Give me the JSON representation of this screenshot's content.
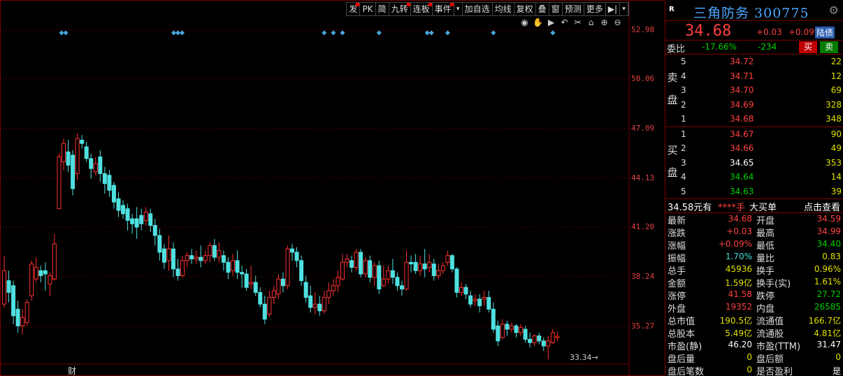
{
  "toolbar": [
    "发",
    "PK",
    "简",
    "九转",
    "连板",
    "事件",
    "▾",
    "加自选",
    "均线",
    "复权",
    "叠",
    "窗",
    "预测",
    "更多",
    "▶|",
    "▾"
  ],
  "toolbar_marked": [
    0,
    3,
    4,
    5
  ],
  "mini_tools": [
    "eye-icon",
    "hand-icon",
    "play-icon",
    "undo-icon",
    "scissors-icon",
    "lock-icon",
    "zoom-in-icon",
    "zoom-out-icon"
  ],
  "mini_glyphs": [
    "◉",
    "✋",
    "▶",
    "↶",
    "✂",
    "⌂",
    "⊕",
    "⊖"
  ],
  "price_axis": [
    "52.98",
    "50.06",
    "47.09",
    "44.13",
    "41.20",
    "38.24",
    "35.27"
  ],
  "bottom_tag": "财",
  "low_label": "33.34",
  "stock": {
    "r_badge": "R",
    "name": "三角防务 300775",
    "price": "34.68",
    "change": "+0.03",
    "change_pct": "+0.09%",
    "market": "陆债"
  },
  "weibi": {
    "label": "委比",
    "ratio": "-17.66%",
    "diff": "-234",
    "buy": "买",
    "sell": "卖"
  },
  "ask_side": [
    "卖",
    "盘"
  ],
  "bid_side": [
    "买",
    "盘"
  ],
  "asks": [
    {
      "lv": "5",
      "p": "34.72",
      "q": "22"
    },
    {
      "lv": "4",
      "p": "34.71",
      "q": "12"
    },
    {
      "lv": "3",
      "p": "34.70",
      "q": "69"
    },
    {
      "lv": "2",
      "p": "34.69",
      "q": "328"
    },
    {
      "lv": "1",
      "p": "34.68",
      "q": "348"
    }
  ],
  "bids": [
    {
      "lv": "1",
      "p": "34.67",
      "q": "90"
    },
    {
      "lv": "2",
      "p": "34.66",
      "q": "49"
    },
    {
      "lv": "3",
      "p": "34.65",
      "q": "353"
    },
    {
      "lv": "4",
      "p": "34.64",
      "q": "14"
    },
    {
      "lv": "5",
      "p": "34.63",
      "q": "39"
    }
  ],
  "info": {
    "a": "34.58元有",
    "b": "****手",
    "c": "大买单",
    "d": "点击查看"
  },
  "stats": [
    {
      "k": "最新",
      "v": "34.68",
      "vc": "red",
      "k2": "开盘",
      "v2": "34.59",
      "v2c": "red"
    },
    {
      "k": "涨跌",
      "v": "+0.03",
      "vc": "red",
      "k2": "最高",
      "v2": "34.99",
      "v2c": "red"
    },
    {
      "k": "涨幅",
      "v": "+0.09%",
      "vc": "red",
      "k2": "最低",
      "v2": "34.40",
      "v2c": "green"
    },
    {
      "k": "振幅",
      "v": "1.70%",
      "vc": "cyan",
      "k2": "量比",
      "v2": "0.83",
      "v2c": "yel"
    },
    {
      "k": "总手",
      "v": "45936",
      "vc": "yel",
      "k2": "换手",
      "v2": "0.96%",
      "v2c": "yel"
    },
    {
      "k": "金额",
      "v": "1.59亿",
      "vc": "yel",
      "k2": "换手(实)",
      "v2": "1.61%",
      "v2c": "yel"
    },
    {
      "k": "涨停",
      "v": "41.58",
      "vc": "red",
      "k2": "跌停",
      "v2": "27.72",
      "v2c": "green"
    },
    {
      "k": "外盘",
      "v": "19352",
      "vc": "red",
      "k2": "内盘",
      "v2": "26585",
      "v2c": "green"
    },
    {
      "k": "总市值",
      "v": "190.5亿",
      "vc": "yel",
      "k2": "流通值",
      "v2": "166.7亿",
      "v2c": "yel"
    },
    {
      "k": "总股本",
      "v": "5.49亿",
      "vc": "yel",
      "k2": "流通股",
      "v2": "4.81亿",
      "v2c": "yel"
    },
    {
      "k": "市盈(静)",
      "v": "46.20",
      "vc": "wht",
      "k2": "市盈(TTM)",
      "v2": "31.47",
      "v2c": "wht"
    },
    {
      "k": "盘后量",
      "v": "0",
      "vc": "yel",
      "k2": "盘后额",
      "v2": "0",
      "v2c": "yel"
    },
    {
      "k": "盘后笔数",
      "v": "0",
      "vc": "yel",
      "k2": "是否盈利",
      "v2": "是",
      "v2c": "wht"
    }
  ],
  "candles": [
    {
      "o": 36.6,
      "c": 38.6,
      "h": 39.5,
      "l": 36.4
    },
    {
      "o": 38.0,
      "c": 37.3,
      "h": 38.6,
      "l": 36.7
    },
    {
      "o": 37.7,
      "c": 35.9,
      "h": 38.0,
      "l": 35.4
    },
    {
      "o": 36.3,
      "c": 35.3,
      "h": 36.8,
      "l": 34.9
    },
    {
      "o": 35.3,
      "c": 35.8,
      "h": 36.3,
      "l": 34.8
    },
    {
      "o": 35.5,
      "c": 36.7,
      "h": 36.9,
      "l": 35.3
    },
    {
      "o": 37.1,
      "c": 39.0,
      "h": 39.2,
      "l": 36.8
    },
    {
      "o": 38.1,
      "c": 38.8,
      "h": 39.4,
      "l": 37.9
    },
    {
      "o": 38.6,
      "c": 38.3,
      "h": 38.9,
      "l": 37.9
    },
    {
      "o": 38.6,
      "c": 38.4,
      "h": 39.1,
      "l": 37.4
    },
    {
      "o": 37.8,
      "c": 38.3,
      "h": 38.5,
      "l": 37.1
    },
    {
      "o": 38.1,
      "c": 40.2,
      "h": 40.8,
      "l": 38.0
    },
    {
      "o": 42.3,
      "c": 45.4,
      "h": 45.6,
      "l": 42.3
    },
    {
      "o": 45.1,
      "c": 46.2,
      "h": 46.5,
      "l": 44.6
    },
    {
      "o": 45.7,
      "c": 44.9,
      "h": 46.4,
      "l": 44.5
    },
    {
      "o": 45.5,
      "c": 43.5,
      "h": 45.8,
      "l": 43.1
    },
    {
      "o": 44.4,
      "c": 46.5,
      "h": 46.8,
      "l": 44.0
    },
    {
      "o": 46.4,
      "c": 46.2,
      "h": 46.7,
      "l": 45.9
    },
    {
      "o": 46.0,
      "c": 45.3,
      "h": 46.3,
      "l": 45.1
    },
    {
      "o": 45.3,
      "c": 44.7,
      "h": 45.6,
      "l": 44.1
    },
    {
      "o": 44.5,
      "c": 45.0,
      "h": 45.4,
      "l": 44.3
    },
    {
      "o": 45.4,
      "c": 44.4,
      "h": 45.8,
      "l": 43.9
    },
    {
      "o": 44.4,
      "c": 43.8,
      "h": 44.8,
      "l": 43.2
    },
    {
      "o": 44.3,
      "c": 43.4,
      "h": 44.6,
      "l": 43.0
    },
    {
      "o": 43.7,
      "c": 42.7,
      "h": 43.9,
      "l": 42.3
    },
    {
      "o": 42.9,
      "c": 42.2,
      "h": 43.3,
      "l": 41.8
    },
    {
      "o": 42.5,
      "c": 42.0,
      "h": 42.8,
      "l": 41.7
    },
    {
      "o": 42.3,
      "c": 41.6,
      "h": 42.6,
      "l": 41.0
    },
    {
      "o": 41.7,
      "c": 41.4,
      "h": 42.0,
      "l": 40.8
    },
    {
      "o": 41.7,
      "c": 41.2,
      "h": 42.4,
      "l": 40.5
    },
    {
      "o": 41.9,
      "c": 41.4,
      "h": 42.3,
      "l": 41.0
    },
    {
      "o": 41.6,
      "c": 42.1,
      "h": 42.4,
      "l": 41.3
    },
    {
      "o": 42.0,
      "c": 41.3,
      "h": 42.3,
      "l": 40.9
    },
    {
      "o": 41.3,
      "c": 40.7,
      "h": 41.7,
      "l": 40.1
    },
    {
      "o": 40.7,
      "c": 39.7,
      "h": 41.1,
      "l": 39.2
    },
    {
      "o": 39.9,
      "c": 39.1,
      "h": 40.2,
      "l": 38.7
    },
    {
      "o": 39.2,
      "c": 39.9,
      "h": 40.7,
      "l": 38.6
    },
    {
      "o": 39.9,
      "c": 38.7,
      "h": 40.3,
      "l": 38.2
    },
    {
      "o": 38.7,
      "c": 38.3,
      "h": 39.3,
      "l": 38.0
    },
    {
      "o": 38.3,
      "c": 39.2,
      "h": 39.5,
      "l": 38.2
    },
    {
      "o": 39.2,
      "c": 39.5,
      "h": 39.7,
      "l": 38.8
    },
    {
      "o": 39.5,
      "c": 39.3,
      "h": 39.9,
      "l": 39.0
    },
    {
      "o": 39.3,
      "c": 39.4,
      "h": 39.8,
      "l": 39.0
    },
    {
      "o": 39.4,
      "c": 39.2,
      "h": 40.1,
      "l": 38.8
    },
    {
      "o": 39.2,
      "c": 39.5,
      "h": 39.8,
      "l": 39.0
    },
    {
      "o": 39.5,
      "c": 40.1,
      "h": 40.3,
      "l": 39.1
    },
    {
      "o": 40.1,
      "c": 39.4,
      "h": 40.5,
      "l": 39.2
    },
    {
      "o": 39.4,
      "c": 39.8,
      "h": 40.3,
      "l": 39.1
    },
    {
      "o": 39.5,
      "c": 39.1,
      "h": 39.8,
      "l": 38.6
    },
    {
      "o": 39.1,
      "c": 38.5,
      "h": 39.4,
      "l": 38.1
    },
    {
      "o": 38.6,
      "c": 39.2,
      "h": 39.6,
      "l": 38.3
    },
    {
      "o": 39.2,
      "c": 38.5,
      "h": 39.8,
      "l": 38.1
    },
    {
      "o": 38.5,
      "c": 38.4,
      "h": 38.9,
      "l": 37.6
    },
    {
      "o": 38.4,
      "c": 37.6,
      "h": 38.7,
      "l": 37.4
    },
    {
      "o": 37.8,
      "c": 37.9,
      "h": 38.9,
      "l": 37.5
    },
    {
      "o": 37.9,
      "c": 37.3,
      "h": 38.3,
      "l": 37.1
    },
    {
      "o": 37.3,
      "c": 36.6,
      "h": 37.6,
      "l": 36.4
    },
    {
      "o": 36.6,
      "c": 35.7,
      "h": 37.1,
      "l": 35.4
    },
    {
      "o": 36.0,
      "c": 37.0,
      "h": 37.4,
      "l": 35.8
    },
    {
      "o": 37.0,
      "c": 37.4,
      "h": 37.7,
      "l": 36.6
    },
    {
      "o": 37.2,
      "c": 38.1,
      "h": 38.4,
      "l": 36.9
    },
    {
      "o": 38.1,
      "c": 37.7,
      "h": 38.5,
      "l": 37.3
    },
    {
      "o": 37.7,
      "c": 39.9,
      "h": 40.1,
      "l": 37.5
    },
    {
      "o": 39.9,
      "c": 39.7,
      "h": 40.2,
      "l": 39.2
    },
    {
      "o": 39.7,
      "c": 39.2,
      "h": 40.0,
      "l": 38.8
    },
    {
      "o": 39.2,
      "c": 38.0,
      "h": 39.5,
      "l": 37.7
    },
    {
      "o": 37.9,
      "c": 37.0,
      "h": 38.3,
      "l": 36.7
    },
    {
      "o": 37.1,
      "c": 36.4,
      "h": 37.7,
      "l": 36.1
    },
    {
      "o": 36.4,
      "c": 36.6,
      "h": 37.3,
      "l": 36.0
    },
    {
      "o": 36.6,
      "c": 36.2,
      "h": 37.1,
      "l": 35.9
    },
    {
      "o": 36.2,
      "c": 37.0,
      "h": 37.4,
      "l": 36.0
    },
    {
      "o": 37.0,
      "c": 37.4,
      "h": 37.9,
      "l": 36.6
    },
    {
      "o": 37.4,
      "c": 37.7,
      "h": 38.1,
      "l": 37.1
    },
    {
      "o": 37.7,
      "c": 38.2,
      "h": 38.6,
      "l": 37.3
    },
    {
      "o": 38.1,
      "c": 39.1,
      "h": 39.6,
      "l": 38.0
    },
    {
      "o": 39.1,
      "c": 39.3,
      "h": 39.6,
      "l": 38.8
    },
    {
      "o": 39.2,
      "c": 38.8,
      "h": 39.5,
      "l": 38.5
    },
    {
      "o": 38.8,
      "c": 39.7,
      "h": 39.9,
      "l": 38.6
    },
    {
      "o": 39.7,
      "c": 38.4,
      "h": 39.9,
      "l": 38.2
    },
    {
      "o": 38.4,
      "c": 39.2,
      "h": 39.4,
      "l": 38.2
    },
    {
      "o": 39.2,
      "c": 38.2,
      "h": 39.5,
      "l": 37.9
    },
    {
      "o": 38.2,
      "c": 38.9,
      "h": 39.1,
      "l": 37.7
    },
    {
      "o": 38.9,
      "c": 37.5,
      "h": 39.2,
      "l": 37.2
    },
    {
      "o": 37.7,
      "c": 38.1,
      "h": 38.9,
      "l": 37.6
    },
    {
      "o": 38.1,
      "c": 38.6,
      "h": 38.9,
      "l": 37.8
    },
    {
      "o": 38.6,
      "c": 38.2,
      "h": 39.3,
      "l": 37.8
    },
    {
      "o": 38.2,
      "c": 37.7,
      "h": 38.5,
      "l": 37.4
    },
    {
      "o": 37.7,
      "c": 37.5,
      "h": 38.0,
      "l": 37.1
    },
    {
      "o": 37.5,
      "c": 39.1,
      "h": 39.8,
      "l": 37.4
    },
    {
      "o": 39.1,
      "c": 39.0,
      "h": 39.5,
      "l": 38.5
    },
    {
      "o": 39.1,
      "c": 38.6,
      "h": 39.6,
      "l": 38.4
    },
    {
      "o": 38.6,
      "c": 39.0,
      "h": 39.5,
      "l": 38.3
    },
    {
      "o": 39.0,
      "c": 38.7,
      "h": 39.9,
      "l": 38.2
    },
    {
      "o": 38.8,
      "c": 39.1,
      "h": 39.6,
      "l": 38.5
    },
    {
      "o": 39.0,
      "c": 38.3,
      "h": 39.3,
      "l": 38.0
    },
    {
      "o": 38.3,
      "c": 38.6,
      "h": 39.0,
      "l": 38.1
    },
    {
      "o": 38.6,
      "c": 38.9,
      "h": 39.1,
      "l": 38.4
    },
    {
      "o": 39.1,
      "c": 39.5,
      "h": 39.8,
      "l": 38.9
    },
    {
      "o": 39.5,
      "c": 38.7,
      "h": 39.6,
      "l": 38.5
    },
    {
      "o": 38.7,
      "c": 37.3,
      "h": 38.8,
      "l": 37.0
    },
    {
      "o": 37.3,
      "c": 37.6,
      "h": 37.9,
      "l": 37.1
    },
    {
      "o": 37.6,
      "c": 37.2,
      "h": 37.8,
      "l": 36.9
    },
    {
      "o": 37.1,
      "c": 36.6,
      "h": 37.4,
      "l": 36.4
    },
    {
      "o": 36.8,
      "c": 36.9,
      "h": 37.2,
      "l": 36.5
    },
    {
      "o": 36.9,
      "c": 36.5,
      "h": 37.2,
      "l": 36.1
    },
    {
      "o": 36.9,
      "c": 37.0,
      "h": 37.4,
      "l": 36.5
    },
    {
      "o": 37.0,
      "c": 36.3,
      "h": 37.4,
      "l": 36.1
    },
    {
      "o": 36.3,
      "c": 35.1,
      "h": 36.7,
      "l": 34.9
    },
    {
      "o": 35.3,
      "c": 34.4,
      "h": 35.6,
      "l": 34.1
    },
    {
      "o": 34.6,
      "c": 35.4,
      "h": 35.7,
      "l": 34.5
    },
    {
      "o": 35.4,
      "c": 35.1,
      "h": 35.6,
      "l": 34.7
    },
    {
      "o": 35.1,
      "c": 35.3,
      "h": 35.5,
      "l": 34.9
    },
    {
      "o": 35.3,
      "c": 34.9,
      "h": 35.4,
      "l": 34.6
    },
    {
      "o": 34.9,
      "c": 35.2,
      "h": 35.4,
      "l": 34.7
    },
    {
      "o": 35.1,
      "c": 34.5,
      "h": 35.3,
      "l": 34.3
    },
    {
      "o": 34.5,
      "c": 34.3,
      "h": 34.9,
      "l": 34.0
    },
    {
      "o": 34.3,
      "c": 34.7,
      "h": 34.8,
      "l": 34.1
    },
    {
      "o": 34.7,
      "c": 34.4,
      "h": 34.9,
      "l": 34.2
    },
    {
      "o": 34.4,
      "c": 34.1,
      "h": 34.6,
      "l": 33.8
    },
    {
      "o": 34.1,
      "c": 34.4,
      "h": 34.7,
      "l": 33.3
    },
    {
      "o": 34.3,
      "c": 34.9,
      "h": 35.1,
      "l": 34.2
    },
    {
      "o": 34.59,
      "c": 34.68,
      "h": 34.99,
      "l": 34.4
    }
  ],
  "markers": [
    {
      "i": 13,
      "n": 2
    },
    {
      "i": 38,
      "n": 3
    },
    {
      "i": 70,
      "n": 1
    },
    {
      "i": 72,
      "n": 1
    },
    {
      "i": 74,
      "n": 1
    },
    {
      "i": 82,
      "n": 1
    },
    {
      "i": 93,
      "n": 2
    },
    {
      "i": 97,
      "n": 1
    },
    {
      "i": 107,
      "n": 1
    },
    {
      "i": 120,
      "n": 1
    }
  ],
  "colors": {
    "up": "#ff3030",
    "down": "#4fe0e0",
    "marker": "#4aa8e0",
    "grid": "#7a0000"
  }
}
